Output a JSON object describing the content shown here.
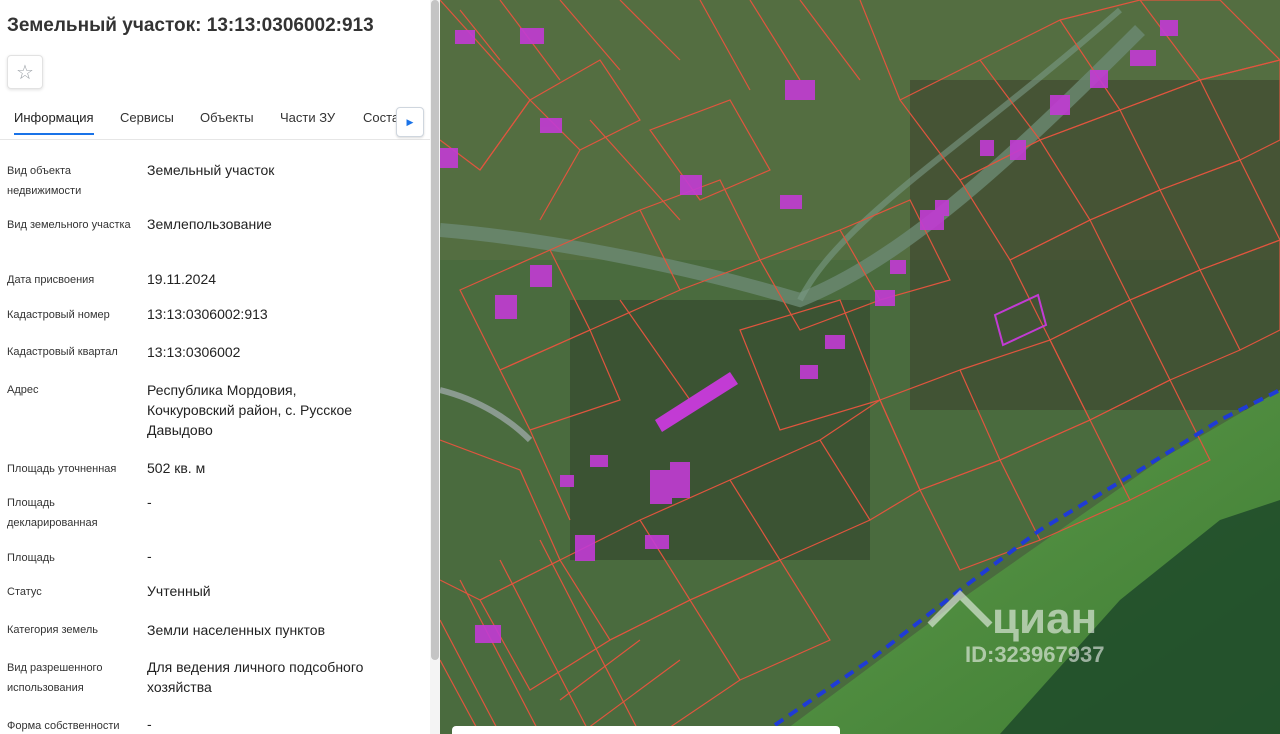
{
  "panel": {
    "title": "Земельный участок: 13:13:0306002:913",
    "star_icon": "☆",
    "tabs": [
      {
        "label": "Информация"
      },
      {
        "label": "Сервисы"
      },
      {
        "label": "Объекты"
      },
      {
        "label": "Части ЗУ"
      },
      {
        "label": "Соста"
      }
    ],
    "tab_next_icon": "▶",
    "rows": [
      {
        "label": "Вид объекта недвижимости",
        "value": "Земельный участок"
      },
      {
        "label": "Вид земельного участка",
        "value": "Землепользование"
      },
      {
        "label": "Дата присвоения",
        "value": "19.11.2024"
      },
      {
        "label": "Кадастровый номер",
        "value": "13:13:0306002:913"
      },
      {
        "label": "Кадастровый квартал",
        "value": "13:13:0306002"
      },
      {
        "label": "Адрес",
        "value": "Республика Мордовия, Кочкуровский район, с. Русское Давыдово"
      },
      {
        "label": "Площадь уточненная",
        "value": "502 кв. м"
      },
      {
        "label": "Площадь декларированная",
        "value": "-"
      },
      {
        "label": "Площадь",
        "value": "-"
      },
      {
        "label": "Статус",
        "value": "Учтенный"
      },
      {
        "label": "Категория земель",
        "value": "Земли населенных пунктов"
      },
      {
        "label": "Вид разрешенного использования",
        "value": "Для ведения личного подсобного хозяйства"
      },
      {
        "label": "Форма собственности",
        "value": "-"
      }
    ]
  },
  "map": {
    "watermark_brand": "циан",
    "watermark_id": "ID:323967937",
    "colors": {
      "parcel_border": "#e0553e",
      "building_fill": "#c23bd4",
      "boundary_line": "#1f3bd6",
      "field_green": "#4f8a3e"
    }
  }
}
